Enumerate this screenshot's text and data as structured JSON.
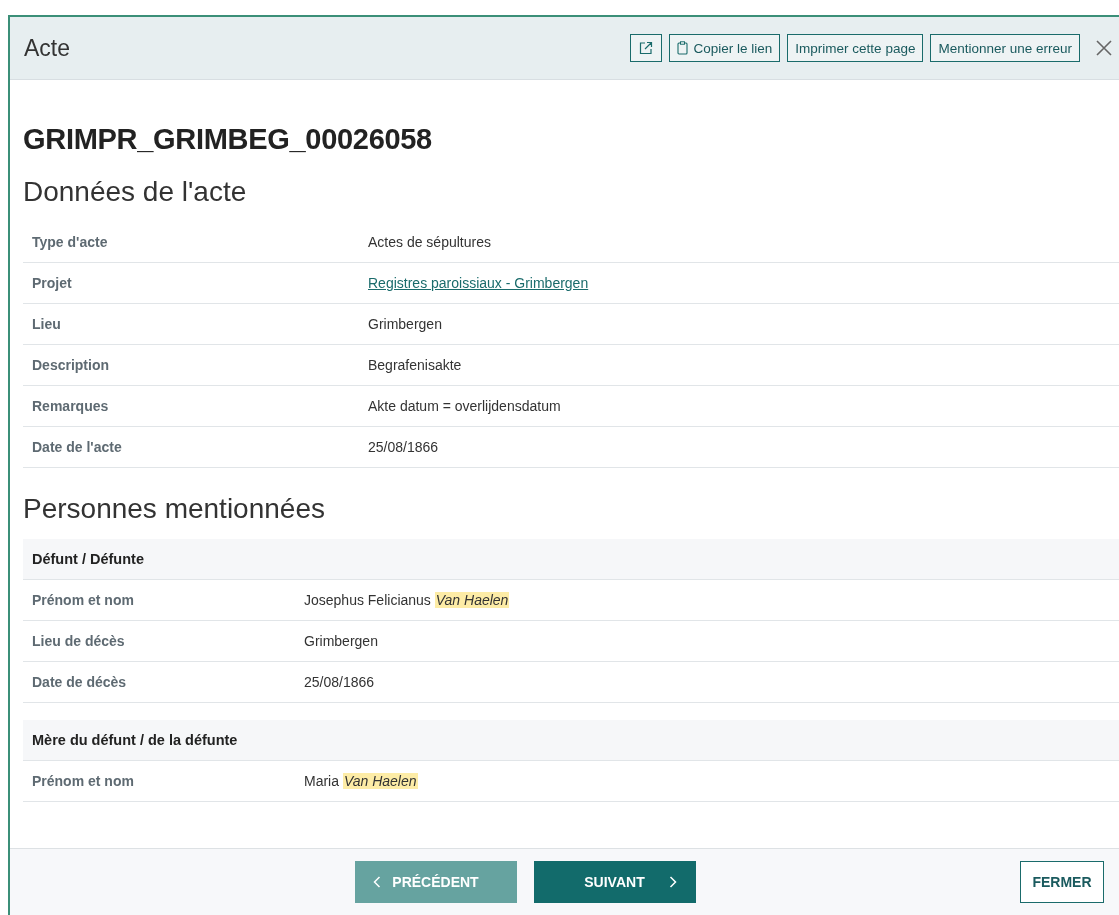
{
  "window": {
    "title": "Acte"
  },
  "toolbar": [
    "Copier le lien",
    "Imprimer cette page",
    "Mentionner une erreur"
  ],
  "record_id": "GRIMPR_GRIMBEG_00026058",
  "record_section": {
    "title": "Données de l'acte",
    "rows": [
      {
        "label": "Type d'acte",
        "value": "Actes de sépultures",
        "kind": "text"
      },
      {
        "label": "Projet",
        "value": "Registres paroissiaux - Grimbergen",
        "kind": "link"
      },
      {
        "label": "Lieu",
        "value": "Grimbergen",
        "kind": "text"
      },
      {
        "label": "Description",
        "value": "Begrafenisakte",
        "kind": "text"
      },
      {
        "label": "Remarques",
        "value": "Akte datum = overlijdensdatum",
        "kind": "text"
      },
      {
        "label": "Date de l'acte",
        "value": "25/08/1866",
        "kind": "text"
      }
    ]
  },
  "persons_section": {
    "title": "Personnes mentionnées",
    "groups": [
      {
        "role": "Défunt / Défunte",
        "rows": [
          {
            "label": "Prénom et nom",
            "value": "Josephus Felicianus",
            "highlight": "Van Haelen"
          },
          {
            "label": "Lieu de décès",
            "value": "Grimbergen"
          },
          {
            "label": "Date de décès",
            "value": "25/08/1866"
          }
        ]
      },
      {
        "role": "Mère du défunt / de la défunte",
        "rows": [
          {
            "label": "Prénom et nom",
            "value": "Maria",
            "highlight": "Van Haelen"
          }
        ]
      }
    ]
  },
  "footer": {
    "previous": "PRÉCÉDENT",
    "next": "SUIVANT",
    "close": "FERMER"
  }
}
